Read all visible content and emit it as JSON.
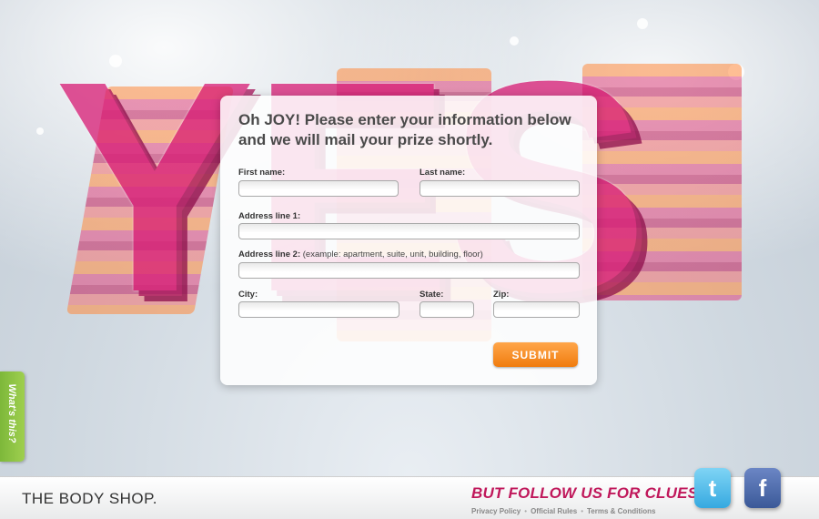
{
  "hero": {
    "word": "YES"
  },
  "form": {
    "headline": "Oh JOY! Please enter your information below and we will mail your prize shortly.",
    "first_name_label": "First name:",
    "last_name_label": "Last name:",
    "address1_label": "Address line 1:",
    "address2_label": "Address line 2:",
    "address2_hint": "(example: apartment, suite, unit, building, floor)",
    "city_label": "City:",
    "state_label": "State:",
    "zip_label": "Zip:",
    "values": {
      "first_name": "",
      "last_name": "",
      "address1": "",
      "address2": "",
      "city": "",
      "state": "",
      "zip": ""
    },
    "submit_label": "SUBMIT"
  },
  "side_tab": {
    "label": "What's this?"
  },
  "footer": {
    "logo_text": "THE BODY SHOP.",
    "follow_text": "BUT FOLLOW US FOR CLUES:",
    "links": [
      "Privacy Policy",
      "Official Rules",
      "Terms & Conditions"
    ],
    "twitter_icon": "twitter-icon",
    "facebook_icon": "facebook-icon"
  },
  "colors": {
    "accent_pink": "#c0185b",
    "submit_orange": "#f07c0e",
    "tab_green": "#8cc63f"
  }
}
